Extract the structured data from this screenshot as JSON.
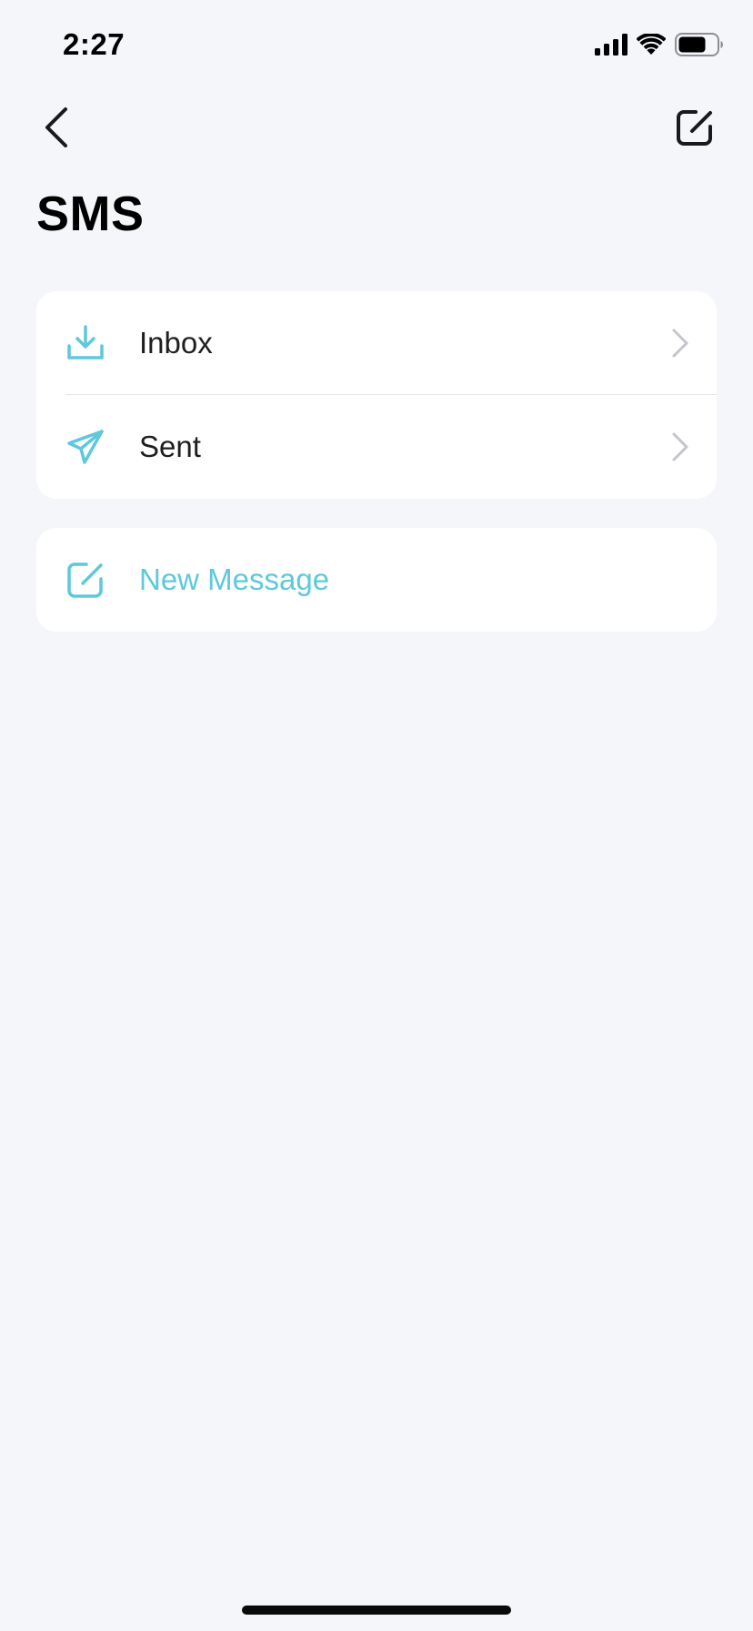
{
  "status_bar": {
    "time": "2:27",
    "icons": [
      "cellular-signal-icon",
      "wifi-icon",
      "battery-icon"
    ]
  },
  "nav": {
    "back_icon": "chevron-left-icon",
    "compose_icon": "compose-icon"
  },
  "page": {
    "title": "SMS"
  },
  "folders": [
    {
      "label": "Inbox",
      "icon": "download-tray-icon"
    },
    {
      "label": "Sent",
      "icon": "paper-plane-icon"
    }
  ],
  "new_message": {
    "label": "New Message",
    "icon": "compose-icon"
  },
  "colors": {
    "background": "#f4f6fa",
    "card": "#ffffff",
    "accent": "#5ec8dc",
    "text": "#1f1f1f",
    "chevron": "#c4c6cc",
    "divider": "#e3e5ea"
  }
}
